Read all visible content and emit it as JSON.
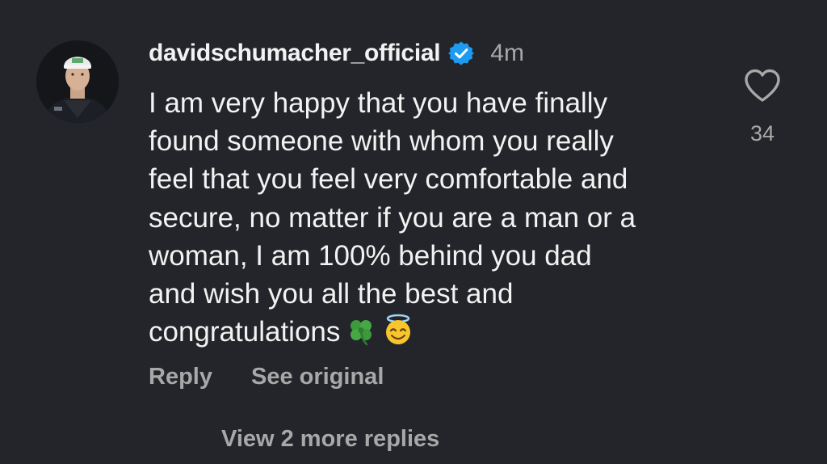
{
  "comment": {
    "username": "davidschumacher_official",
    "verified_icon": "verified-badge-icon",
    "timestamp": "4m",
    "text_lines": [
      "I am very happy that you have finally",
      "found someone with whom you really",
      "feel that you feel very comfortable and",
      "secure, no matter if you are a man or a",
      "woman, I am 100% behind you dad",
      "and wish you all the best and",
      "congratulations"
    ],
    "emojis": [
      "four-leaf-clover-icon",
      "smiling-face-with-halo-icon"
    ],
    "actions": {
      "reply_label": "Reply",
      "see_original_label": "See original"
    },
    "like": {
      "icon": "heart-outline-icon",
      "count": "34"
    },
    "more_replies_label": "View 2 more replies"
  },
  "colors": {
    "background": "#23252a",
    "text_primary": "#f2f2f2",
    "text_secondary": "#a8a8a8",
    "verified_blue": "#1d9bf0"
  }
}
